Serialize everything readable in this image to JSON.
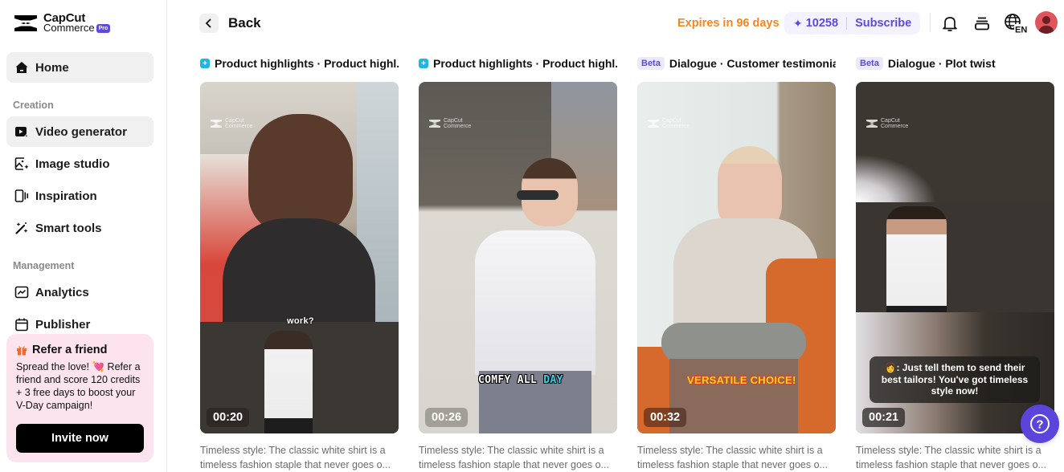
{
  "brand": {
    "line1": "CapCut",
    "line2": "Commerce",
    "badge": "Pro"
  },
  "sidebar": {
    "home": "Home",
    "sections": [
      {
        "label": "Creation",
        "items": [
          "Video generator",
          "Image studio",
          "Inspiration",
          "Smart tools"
        ]
      },
      {
        "label": "Management",
        "items": [
          "Analytics",
          "Publisher"
        ]
      }
    ],
    "active_item": "Video generator"
  },
  "refer": {
    "title": "Refer a friend",
    "body": "Spread the love! 💘 Refer a friend and score 120 credits + 3 free days to boost your V-Day campaign!",
    "button": "Invite now"
  },
  "header": {
    "back": "Back",
    "expires": "Expires in 96 days",
    "credits": "10258",
    "subscribe": "Subscribe",
    "language": "EN",
    "icons": [
      "bell-icon",
      "inbox-icon",
      "globe-language-icon",
      "user-avatar"
    ]
  },
  "colors": {
    "accent": "#5b4bdb",
    "expires": "#f5861f",
    "referBg": "#fde3ee"
  },
  "cards": [
    {
      "tag": "icon",
      "title": "Product highlights · Product highl...",
      "duration": "00:20",
      "caption": "work?",
      "description": "Timeless style: The classic white shirt is a timeless fashion staple that never goes o..."
    },
    {
      "tag": "icon",
      "title": "Product highlights · Product highl...",
      "duration": "00:26",
      "caption": "COMFY ALL",
      "caption_highlight": "DAY",
      "description": "Timeless style: The classic white shirt is a timeless fashion staple that never goes o..."
    },
    {
      "tag": "Beta",
      "title": "Dialogue · Customer testimonial",
      "duration": "00:32",
      "caption": "VERSATILE CHOICE!",
      "description": "Timeless style: The classic white shirt is a timeless fashion staple that never goes o..."
    },
    {
      "tag": "Beta",
      "title": "Dialogue · Plot twist",
      "duration": "00:21",
      "caption": "👩: Just tell them to send their best tailors! You've got timeless style now!",
      "description": "Timeless style: The classic white shirt is a timeless fashion staple that never goes o..."
    }
  ],
  "watermark": {
    "line1": "CapCut",
    "line2": "Commerce"
  },
  "help": "?"
}
